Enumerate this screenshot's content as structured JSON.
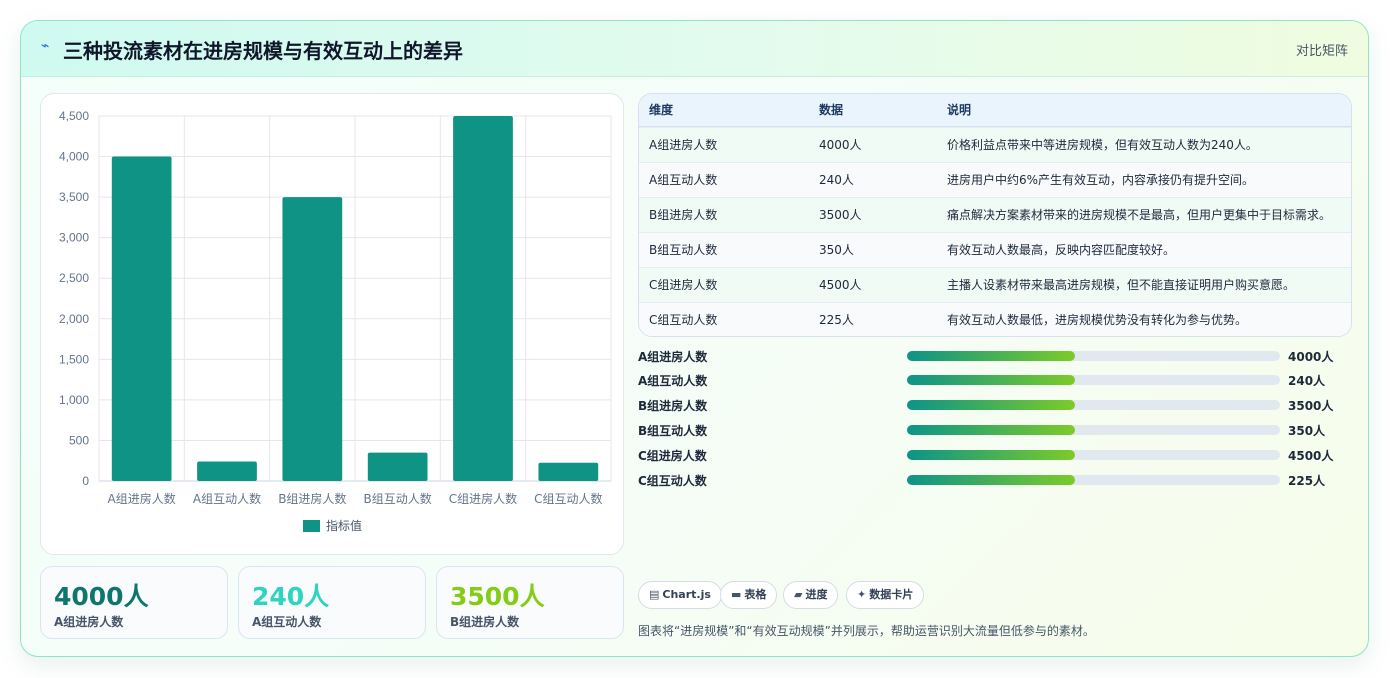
{
  "header": {
    "icon": "lightning-icon",
    "title": "三种投流素材在进房规模与有效互动上的差异",
    "tag": "对比矩阵"
  },
  "chart_data": {
    "type": "bar",
    "categories": [
      "A组进房人数",
      "A组互动人数",
      "B组进房人数",
      "B组互动人数",
      "C组进房人数",
      "C组互动人数"
    ],
    "series": [
      {
        "name": "指标值",
        "values": [
          4000,
          240,
          3500,
          350,
          4500,
          225
        ],
        "color": "#0e9384"
      }
    ],
    "ylim": [
      0,
      4500
    ],
    "yticks": [
      "0",
      "500",
      "1,000",
      "1,500",
      "2,000",
      "2,500",
      "3,000",
      "3,500",
      "4,000",
      "4,500"
    ],
    "grid": true,
    "legend": "bottom"
  },
  "table": {
    "headers": [
      "维度",
      "数据",
      "说明"
    ],
    "rows": [
      [
        "A组进房人数",
        "4000人",
        "价格利益点带来中等进房规模，但有效互动人数为240人。"
      ],
      [
        "A组互动人数",
        "240人",
        "进房用户中约6%产生有效互动，内容承接仍有提升空间。"
      ],
      [
        "B组进房人数",
        "3500人",
        "痛点解决方案素材带来的进房规模不是最高，但用户更集中于目标需求。"
      ],
      [
        "B组互动人数",
        "350人",
        "有效互动人数最高，反映内容匹配度较好。"
      ],
      [
        "C组进房人数",
        "4500人",
        "主播人设素材带来最高进房规模，但不能直接证明用户购买意愿。"
      ],
      [
        "C组互动人数",
        "225人",
        "有效互动人数最低，进房规模优势没有转化为参与优势。"
      ]
    ]
  },
  "progress": [
    {
      "label": "A组进房人数",
      "value": "4000人",
      "fill": 0.45
    },
    {
      "label": "A组互动人数",
      "value": "240人",
      "fill": 0.45
    },
    {
      "label": "B组进房人数",
      "value": "3500人",
      "fill": 0.45
    },
    {
      "label": "B组互动人数",
      "value": "350人",
      "fill": 0.45
    },
    {
      "label": "C组进房人数",
      "value": "4500人",
      "fill": 0.45
    },
    {
      "label": "C组互动人数",
      "value": "225人",
      "fill": 0.45
    }
  ],
  "stats": [
    {
      "value": "4000人",
      "label": "A组进房人数",
      "color": "#0f766e"
    },
    {
      "value": "240人",
      "label": "A组互动人数",
      "color": "#2dd4bf"
    },
    {
      "value": "3500人",
      "label": "B组进房人数",
      "color": "#84cc16"
    }
  ],
  "chips": [
    {
      "icon": "chart-icon",
      "glyph": "▤",
      "label": "Chart.js"
    },
    {
      "icon": "table-icon",
      "glyph": "▬",
      "label": "表格"
    },
    {
      "icon": "progress-icon",
      "glyph": "▰",
      "label": "进度"
    },
    {
      "icon": "sparkle-icon",
      "glyph": "✦",
      "label": "数据卡片"
    }
  ],
  "footnote": "图表将“进房规模”和“有效互动规模”并列展示，帮助运营识别大流量但低参与的素材。"
}
